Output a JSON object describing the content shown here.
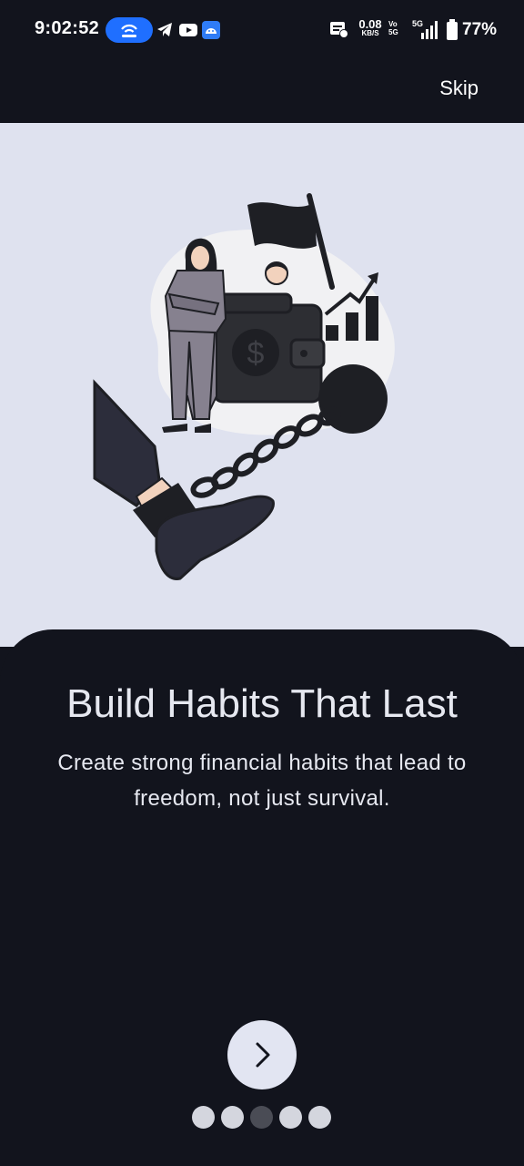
{
  "status_bar": {
    "time": "9:02:52",
    "net_speed": "0.08",
    "net_speed_unit": "KB/S",
    "volte": "Vo 5G",
    "network": "5G",
    "battery": "77%"
  },
  "header": {
    "skip_label": "Skip"
  },
  "slide": {
    "title": "Build Habits That Last",
    "subtitle": "Create strong financial habits that lead to freedom, not just survival."
  },
  "pager": {
    "total": 5,
    "active_index": 2
  },
  "colors": {
    "background": "#12141d",
    "hero_background": "#dfe2ef",
    "text": "#e6e8f0",
    "button": "#e2e5f2",
    "dot": "#d4d6de",
    "dot_active": "#4a4c55",
    "hotspot": "#1f6fff"
  },
  "icons": {
    "next_button": "chevron-right-icon",
    "hotspot": "hotspot-icon",
    "telegram": "telegram-icon",
    "youtube": "youtube-icon",
    "app": "android-icon"
  }
}
